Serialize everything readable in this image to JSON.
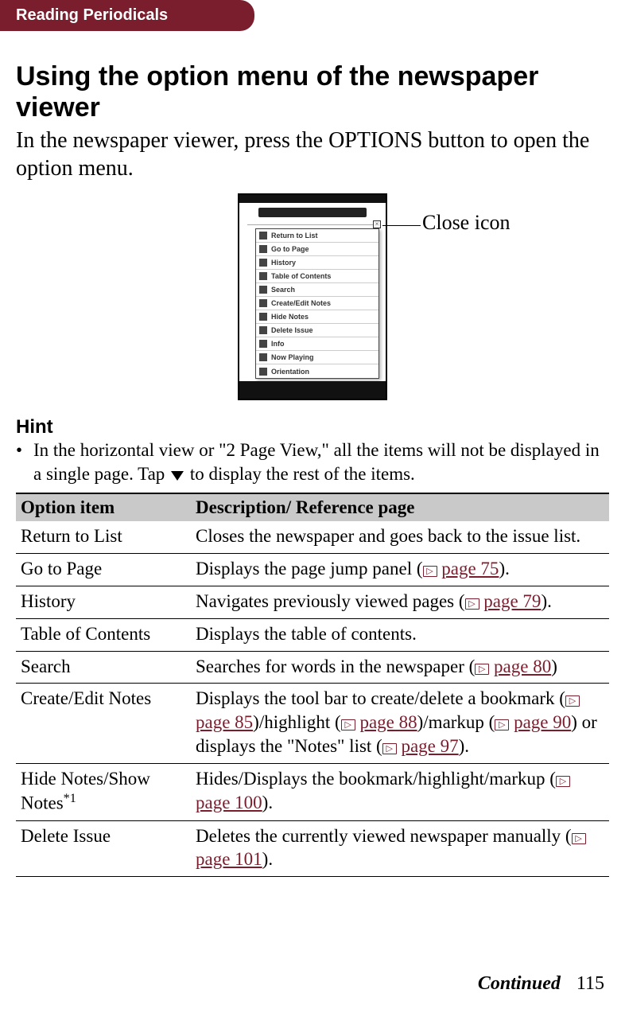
{
  "header": {
    "chapter": "Reading Periodicals"
  },
  "title": "Using the option menu of the newspaper viewer",
  "intro": "In the newspaper viewer, press the OPTIONS button to open the option menu.",
  "figure": {
    "callout": "Close icon",
    "menu_items": [
      "Return to List",
      "Go to Page",
      "History",
      "Table of Contents",
      "Search",
      "Create/Edit Notes",
      "Hide Notes",
      "Delete Issue",
      "Info",
      "Now Playing",
      "Orientation"
    ]
  },
  "hint": {
    "heading": "Hint",
    "text_before": "In the horizontal view or \"2 Page View,\" all the items will not be displayed in a single page. Tap ",
    "text_after": " to display the rest of the items."
  },
  "table": {
    "head_option": "Option item",
    "head_desc": "Description/ Reference page",
    "rows": {
      "return": {
        "item": "Return to List",
        "desc": "Closes the newspaper and goes back to the issue list."
      },
      "goto": {
        "item": "Go to Page",
        "d1": "Displays the page jump panel (",
        "p1": "page 75",
        "d2": ")."
      },
      "hist": {
        "item": "History",
        "d1": "Navigates previously viewed pages (",
        "p1": "page 79",
        "d2": ")."
      },
      "toc": {
        "item": "Table of Contents",
        "desc": "Displays the table of contents."
      },
      "search": {
        "item": "Search",
        "d1": "Searches for words in the newspaper (",
        "p1": "page 80",
        "d2": ")"
      },
      "notes": {
        "item": "Create/Edit Notes",
        "d1": "Displays the tool bar to create/delete a bookmark (",
        "p1": "page 85",
        "d2": ")/highlight (",
        "p2": "page 88",
        "d3": ")/markup (",
        "p3": "page 90",
        "d4": ") or displays the \"Notes\" list (",
        "p4": "page 97",
        "d5": ")."
      },
      "hide": {
        "item": "Hide Notes/Show Notes",
        "sup": "*1",
        "d1": "Hides/Displays the bookmark/highlight/markup (",
        "p1": "page 100",
        "d2": ")."
      },
      "delete": {
        "item": "Delete Issue",
        "d1": "Deletes the currently viewed newspaper manually (",
        "p1": "page 101",
        "d2": ")."
      }
    }
  },
  "footer": {
    "continued": "Continued",
    "page": "115"
  }
}
